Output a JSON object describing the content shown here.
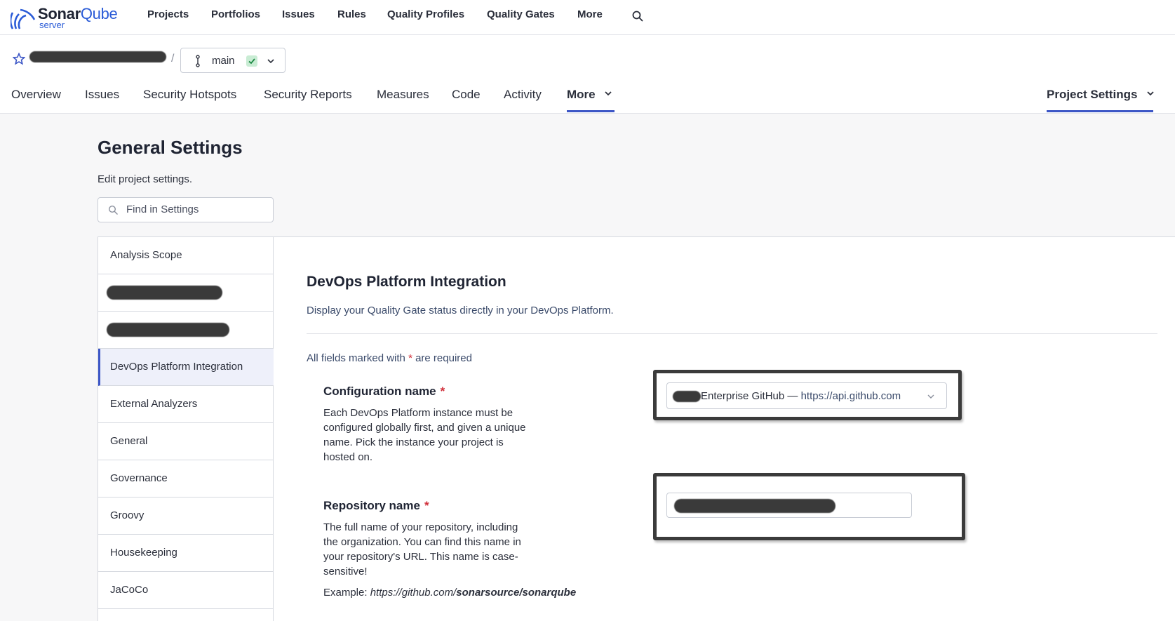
{
  "brand": {
    "name_bold": "Sonar",
    "name_light": "Qube",
    "sub": "server",
    "accent": "#2a5bd7"
  },
  "topnav": {
    "items": [
      "Projects",
      "Portfolios",
      "Issues",
      "Rules",
      "Quality Profiles",
      "Quality Gates",
      "More"
    ]
  },
  "project": {
    "separator": "/",
    "branch": "main"
  },
  "tabs": {
    "items": [
      "Overview",
      "Issues",
      "Security Hotspots",
      "Security Reports",
      "Measures",
      "Code",
      "Activity"
    ],
    "more": "More",
    "project_settings": "Project Settings"
  },
  "page": {
    "title": "General Settings",
    "subtitle": "Edit project settings.",
    "search_placeholder": "Find in Settings"
  },
  "categories": [
    "Analysis Scope",
    "",
    "",
    "DevOps Platform Integration",
    "External Analyzers",
    "General",
    "Governance",
    "Groovy",
    "Housekeeping",
    "JaCoCo"
  ],
  "section": {
    "title": "DevOps Platform Integration",
    "description": "Display your Quality Gate status directly in your DevOps Platform.",
    "required_prefix": "All fields marked with",
    "required_asterisk": "*",
    "required_suffix": "are required"
  },
  "fields": {
    "config": {
      "label": "Configuration name",
      "help": "Each DevOps Platform instance must be configured globally first, and given a unique name. Pick the instance your project is hosted on.",
      "selected_name": "Enterprise GitHub — ",
      "selected_url": "https://api.github.com"
    },
    "repo": {
      "label": "Repository name",
      "help": "The full name of your repository, including the organization. You can find this name in your repository's URL. This name is case-sensitive!",
      "example_label": "Example:",
      "example_prefix": "https://github.com/",
      "example_bold": "sonarsource/sonarqube"
    }
  }
}
